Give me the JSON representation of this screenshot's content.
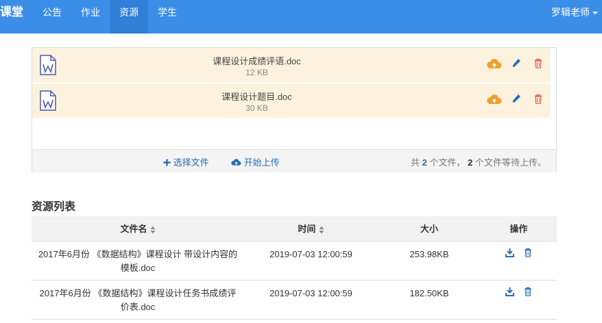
{
  "navbar": {
    "brand": "课堂",
    "items": [
      {
        "label": "公告"
      },
      {
        "label": "作业"
      },
      {
        "label": "资源"
      },
      {
        "label": "学生"
      }
    ],
    "active_index": 2,
    "user": "罗辑老师"
  },
  "uploader": {
    "files": [
      {
        "name": "课程设计成绩评语.doc",
        "size": "12 KB"
      },
      {
        "name": "课程设计题目.doc",
        "size": "30 KB"
      }
    ],
    "pick_label": "选择文件",
    "upload_label": "开始上传",
    "summary": {
      "prefix": "共",
      "count": "2",
      "mid": "个文件，",
      "pending": "2",
      "suffix": "个文件等待上传。"
    }
  },
  "resources": {
    "title": "资源列表",
    "columns": [
      "文件名",
      "时间",
      "大小",
      "操作"
    ],
    "rows": [
      {
        "name": "2017年6月份 《数据结构》课程设计 带设计内容的模板.doc",
        "time": "2019-07-03 12:00:59",
        "size": "253.98KB"
      },
      {
        "name": "2017年6月份 《数据结构》课程设计任务书成绩评价表.doc",
        "time": "2019-07-03 12:00:59",
        "size": "182.50KB"
      }
    ]
  },
  "colors": {
    "navbar": "#3b8ee8",
    "file_row": "#fcf2dd",
    "upload_icon": "#f0a030",
    "edit_icon": "#2a6db5",
    "delete_icon": "#e06050"
  }
}
